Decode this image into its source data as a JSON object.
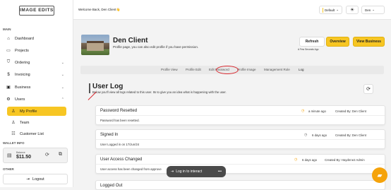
{
  "app": {
    "logo_text": "IMAGE EDITS"
  },
  "sidebar": {
    "main_label": "MAIN",
    "items": [
      {
        "label": "Dashboard",
        "icon": "home-icon"
      },
      {
        "label": "Projects",
        "icon": "folder-icon"
      },
      {
        "label": "Ordering",
        "icon": "cart-icon"
      },
      {
        "label": "Invoicing",
        "icon": "dollar-icon"
      },
      {
        "label": "Business",
        "icon": "briefcase-icon"
      },
      {
        "label": "Users",
        "icon": "gear-icon"
      }
    ],
    "subitems": [
      {
        "label": "My Profile",
        "icon": "user-icon"
      },
      {
        "label": "Team",
        "icon": "team-icon"
      },
      {
        "label": "Customer List",
        "icon": "list-icon"
      }
    ],
    "wallet_label": "WALLET INFO",
    "wallet": {
      "balance_label": "Balance",
      "amount": "$11.50"
    },
    "other_label": "OTHER",
    "logout_label": "Logout"
  },
  "topbar": {
    "welcome": "Welcome Back, Den Client👋",
    "theme_select": "Default",
    "user_menu": "Den"
  },
  "profile": {
    "name": "Den Client",
    "description": "Profile page, you can also edit profile if you have permission.",
    "refresh_label": "Refresh",
    "refresh_note": "A Few Seconds Ago",
    "overview_label": "Overview",
    "view_business_label": "View Business"
  },
  "tabs": [
    "Profile View",
    "Profile Edit",
    "Edit Password",
    "Profile Image",
    "Management Role",
    "Log"
  ],
  "user_log": {
    "title": "User Log",
    "description": "Below you'll view all logs related to this user. Its to give you an idea what is happening with the user.",
    "entries": [
      {
        "title": "Password Resetted",
        "when": "a minute ago",
        "by": "Created By: Den Client",
        "body": "Password has been resetted.",
        "status": "warning"
      },
      {
        "title": "Signed In",
        "when": "6 days ago",
        "by": "Created By: Den Client",
        "body": "User Logged in on 17/Jun/24",
        "status": "info"
      },
      {
        "title": "User Access Changed",
        "when": "6 days ago",
        "by": "Created By: Haydnne2 Admin",
        "body": "User access has been changed from approve",
        "status": "warning"
      },
      {
        "title": "Logged Out",
        "when": "",
        "by": "",
        "body": "",
        "status": ""
      }
    ]
  },
  "toast": {
    "text": "Log in to interact",
    "more": "•••"
  },
  "colors": {
    "accent": "#f7c623",
    "annotation_red": "#d9282f",
    "warning": "#f5a30b"
  }
}
